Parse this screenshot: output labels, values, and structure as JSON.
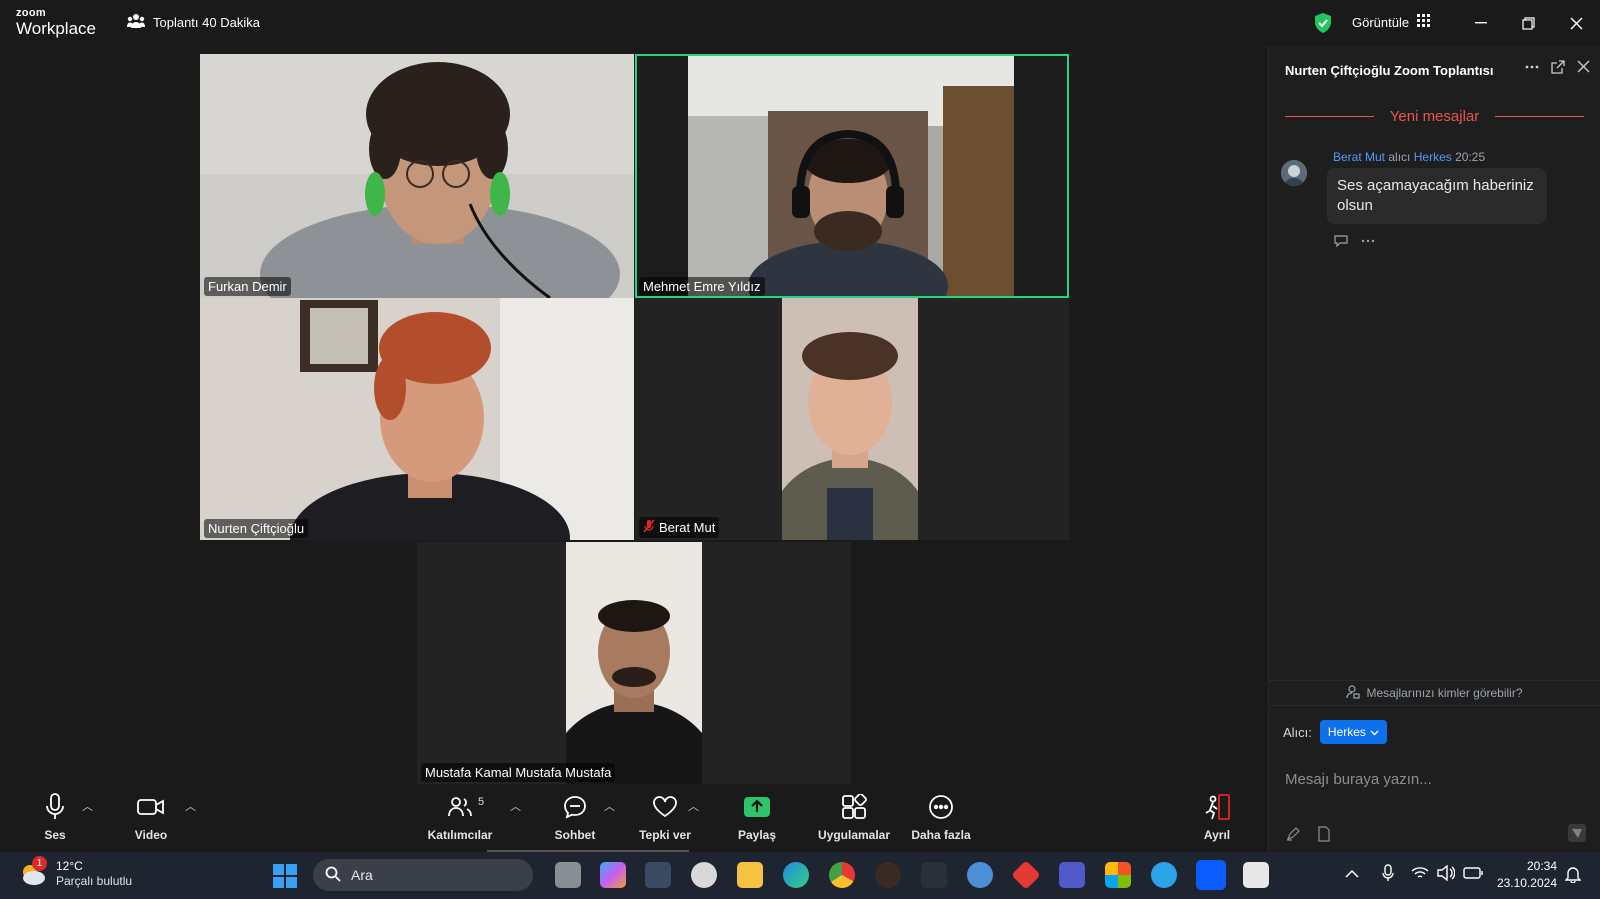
{
  "app": {
    "logo_small": "zoom",
    "logo_big": "Workplace",
    "meeting_timer": "Toplantı 40 Dakika",
    "view_label": "Görüntüle"
  },
  "participants": [
    {
      "name": "Furkan Demir"
    },
    {
      "name": "Mehmet Emre Yıldız"
    },
    {
      "name": "Nurten Çiftçioğlu"
    },
    {
      "name": "Berat Mut"
    },
    {
      "name": "Mustafa Kamal Mustafa Mustafa"
    }
  ],
  "chat": {
    "title": "Nurten Çiftçioğlu Zoom Toplantısı",
    "new_messages": "Yeni mesajlar",
    "message": {
      "sender": "Berat Mut",
      "to_word": "alıcı",
      "recipient": "Herkes",
      "time": "20:25",
      "text": "Ses açamayacağım haberiniz olsun"
    },
    "privacy_text": "Mesajlarınızı kimler görebilir?",
    "recipient_label": "Alıcı:",
    "recipient_value": "Herkes",
    "input_placeholder": "Mesajı buraya yazın..."
  },
  "toolbar": {
    "audio": "Ses",
    "video": "Video",
    "participants": "Katılımcılar",
    "participants_count": "5",
    "chat": "Sohbet",
    "react": "Tepki ver",
    "share": "Paylaş",
    "apps": "Uygulamalar",
    "more": "Daha fazla",
    "leave": "Ayrıl"
  },
  "taskbar": {
    "weather_badge": "1",
    "temperature": "12°C",
    "weather_desc": "Parçalı bulutlu",
    "search_placeholder": "Ara",
    "time": "20:34",
    "date": "23.10.2024"
  },
  "colors": {
    "active_speaker": "#23d57c",
    "accent_blue": "#0e71eb",
    "new_messages": "#e5564b",
    "share_green": "#2ec56a",
    "leave_red": "#e02828"
  }
}
